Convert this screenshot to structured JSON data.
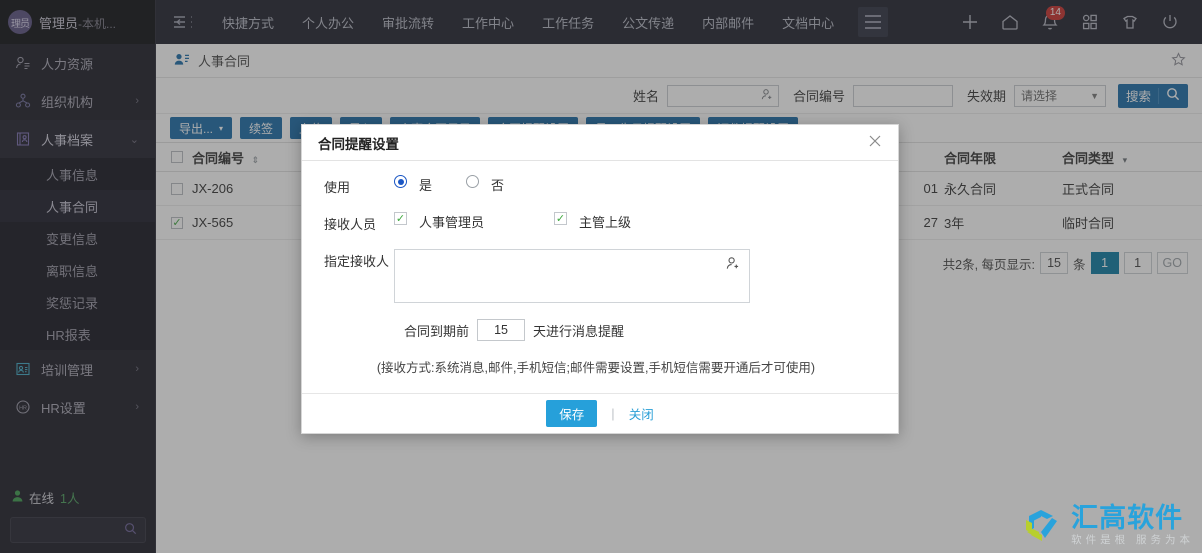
{
  "sidebar": {
    "user": {
      "avatar_text": "理员",
      "name": "管理员",
      "suffix": "-本机..."
    },
    "top_item": {
      "label": "人力资源",
      "icon": "person-lines-icon"
    },
    "items": [
      {
        "label": "组织机构",
        "icon": "org-icon",
        "chevron": "›"
      },
      {
        "label": "人事档案",
        "icon": "archive-icon",
        "chevron": "⌄"
      },
      {
        "label": "培训管理",
        "icon": "training-icon",
        "chevron": "›"
      },
      {
        "label": "HR设置",
        "icon": "hr-settings-icon",
        "chevron": "›"
      }
    ],
    "sub_items": [
      {
        "label": "人事信息"
      },
      {
        "label": "人事合同"
      },
      {
        "label": "变更信息"
      },
      {
        "label": "离职信息"
      },
      {
        "label": "奖惩记录"
      },
      {
        "label": "HR报表"
      }
    ],
    "online": {
      "label": "在线",
      "count": "1人",
      "icon": "person-filled-icon"
    },
    "search_placeholder": "",
    "search_icon": "search-icon"
  },
  "topnav": {
    "collapse_icon": "collapse-menu-icon",
    "links": [
      "快捷方式",
      "个人办公",
      "审批流转",
      "工作中心",
      "工作任务",
      "公文传递",
      "内部邮件",
      "文档中心"
    ],
    "grid_toggle_icon": "hamburger-icon",
    "right_icons": [
      {
        "name": "plus-icon",
        "glyph": "+"
      },
      {
        "name": "home-icon",
        "glyph": "⌂"
      },
      {
        "name": "bell-icon",
        "glyph": "🔔",
        "badge": "14"
      },
      {
        "name": "apps-grid-icon",
        "glyph": "▦"
      },
      {
        "name": "shirt-icon",
        "glyph": "👕"
      },
      {
        "name": "power-icon",
        "glyph": "⏻"
      }
    ]
  },
  "breadcrumb": {
    "label": "人事合同",
    "icon": "contact-card-icon",
    "star_icon": "star-icon"
  },
  "filterbar": {
    "name_label": "姓名",
    "name_value": "",
    "name_picker_icon": "user-picker-icon",
    "contract_no_label": "合同编号",
    "contract_no_value": "",
    "expire_label": "失效期",
    "expire_value": "请选择",
    "search_label": "搜索",
    "search_icon": "search-icon"
  },
  "toolbar": {
    "buttons": [
      {
        "label": "导出...",
        "caret": "▾"
      },
      {
        "label": "续签"
      },
      {
        "label": "上传"
      },
      {
        "label": "导入"
      },
      {
        "label": "人事合同目录"
      },
      {
        "label": "合同提醒设置"
      },
      {
        "label": "员工生日提醒设置"
      },
      {
        "label": "证件提醒设置"
      }
    ]
  },
  "table": {
    "headers": [
      {
        "label": "合同编号",
        "sort": "⇕"
      },
      {
        "label": "合同年限"
      },
      {
        "label": "合同类型",
        "caret": "▾"
      }
    ],
    "rows": [
      {
        "checked": false,
        "no": "JX-206",
        "hidden_tail": "01",
        "years": "永久合同",
        "type": "正式合同"
      },
      {
        "checked": true,
        "no": "JX-565",
        "hidden_tail": "27",
        "years": "3年",
        "type": "临时合同"
      }
    ]
  },
  "pager": {
    "summary": "共2条, 每页显示:",
    "page_size": "15",
    "unit": "条",
    "current_page": "1",
    "jump_page": "1",
    "go_label": "GO"
  },
  "modal": {
    "title": "合同提醒设置",
    "close_icon": "close-icon",
    "use_label": "使用",
    "use_yes": "是",
    "use_no": "否",
    "use_value": "是",
    "receiver_label": "接收人员",
    "receiver_options": [
      {
        "label": "人事管理员",
        "checked": true
      },
      {
        "label": "主管上级",
        "checked": true
      }
    ],
    "assign_label": "指定接收人",
    "assign_value": "",
    "assign_picker_icon": "user-picker-icon",
    "days_prefix": "合同到期前",
    "days_value": "15",
    "days_suffix": "天进行消息提醒",
    "hint": "(接收方式:系统消息,邮件,手机短信;邮件需要设置,手机短信需要开通后才可使用)",
    "save_label": "保存",
    "close_label": "关闭"
  },
  "watermark": {
    "main": "汇高软件",
    "sub": "软件是根 服务为本",
    "logo_icon": "huigao-logo-icon"
  },
  "colors": {
    "accent_blue": "#1b6ca8",
    "save_blue": "#26a0da",
    "sidebar_bg": "#1c1c26",
    "topnav_bg": "#20222e",
    "badge_red": "#c9302c",
    "check_green": "#3ea83e"
  }
}
